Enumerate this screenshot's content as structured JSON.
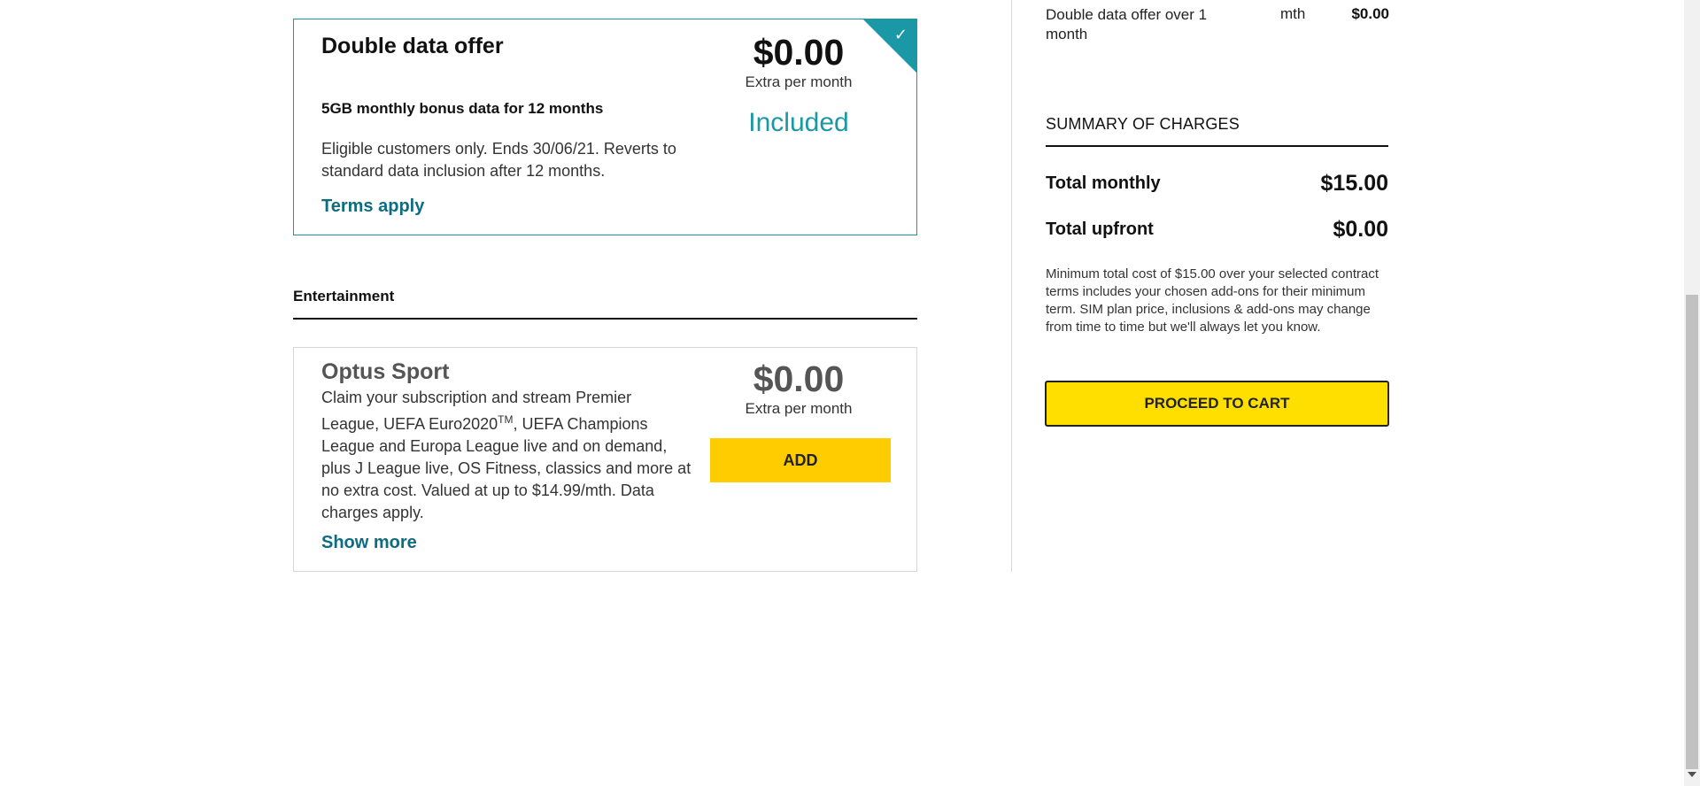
{
  "offer": {
    "title": "Double data offer",
    "subtitle": "5GB monthly bonus data for 12 months",
    "description": "Eligible customers only. Ends 30/06/21. Reverts to standard data inclusion after 12 months.",
    "terms_link": "Terms apply",
    "price": "$0.00",
    "price_per": "Extra per month",
    "status": "Included",
    "check_icon": "✓"
  },
  "entertainment": {
    "heading": "Entertainment",
    "addon": {
      "title": "Optus Sport",
      "description_pre": "Claim your subscription and stream Premier League, UEFA Euro2020",
      "description_sup": "TM",
      "description_post": ", UEFA Champions League and Europa League live and on demand, plus J League live, OS Fitness, classics and more at no extra cost. Valued at up to $14.99/mth. Data charges apply.",
      "show_more": "Show more",
      "price": "$0.00",
      "price_per": "Extra per month",
      "add_label": "ADD"
    }
  },
  "summary": {
    "line_item": {
      "name": "Double data offer over 1 month",
      "unit": "mth",
      "value": "$0.00"
    },
    "heading": "SUMMARY OF CHARGES",
    "total_monthly_label": "Total monthly",
    "total_monthly_value": "$15.00",
    "total_upfront_label": "Total upfront",
    "total_upfront_value": "$0.00",
    "disclaimer": "Minimum total cost of $15.00 over your selected contract terms includes your chosen add-ons for their minimum term. SIM plan price, inclusions & add-ons may change from time to time but we'll always let you know.",
    "cta_label": "PROCEED TO CART"
  },
  "colors": {
    "accent_teal": "#1b98a6",
    "link": "#0e6c80",
    "cta_yellow": "#ffdf00",
    "add_yellow": "#ffcc00"
  }
}
